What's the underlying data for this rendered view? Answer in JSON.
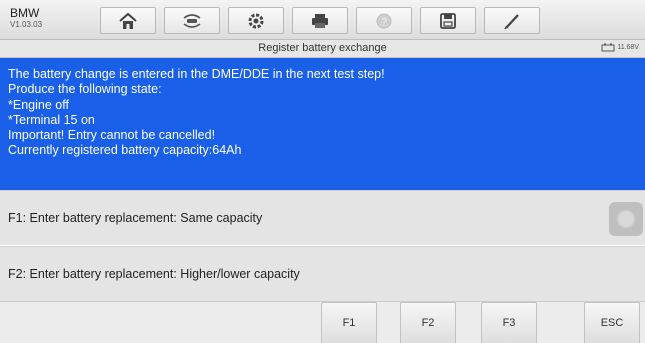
{
  "header": {
    "brand": "BMW",
    "version": "V1.03.03",
    "toolbar": [
      {
        "name": "home-icon"
      },
      {
        "name": "vehicle-swap-icon"
      },
      {
        "name": "settings-icon"
      },
      {
        "name": "print-icon"
      },
      {
        "name": "help-icon"
      },
      {
        "name": "save-icon"
      },
      {
        "name": "edit-icon"
      }
    ]
  },
  "title": {
    "text": "Register battery exchange",
    "battery_voltage": "11.68V"
  },
  "message": {
    "lines": [
      "The battery change is entered in the DME/DDE in the next test step!",
      "Produce the following state:",
      "*Engine off",
      "*Terminal 15 on",
      "Important! Entry cannot be cancelled!",
      "Currently registered battery capacity:64Ah"
    ]
  },
  "options": [
    {
      "label": "F1: Enter battery replacement: Same capacity"
    },
    {
      "label": "F2: Enter battery replacement: Higher/lower capacity"
    }
  ],
  "footer": {
    "f1": "F1",
    "f2": "F2",
    "f3": "F3",
    "esc": "ESC"
  },
  "colors": {
    "message_bg": "#1a5fe8",
    "option_bg": "#e4e4e4"
  }
}
